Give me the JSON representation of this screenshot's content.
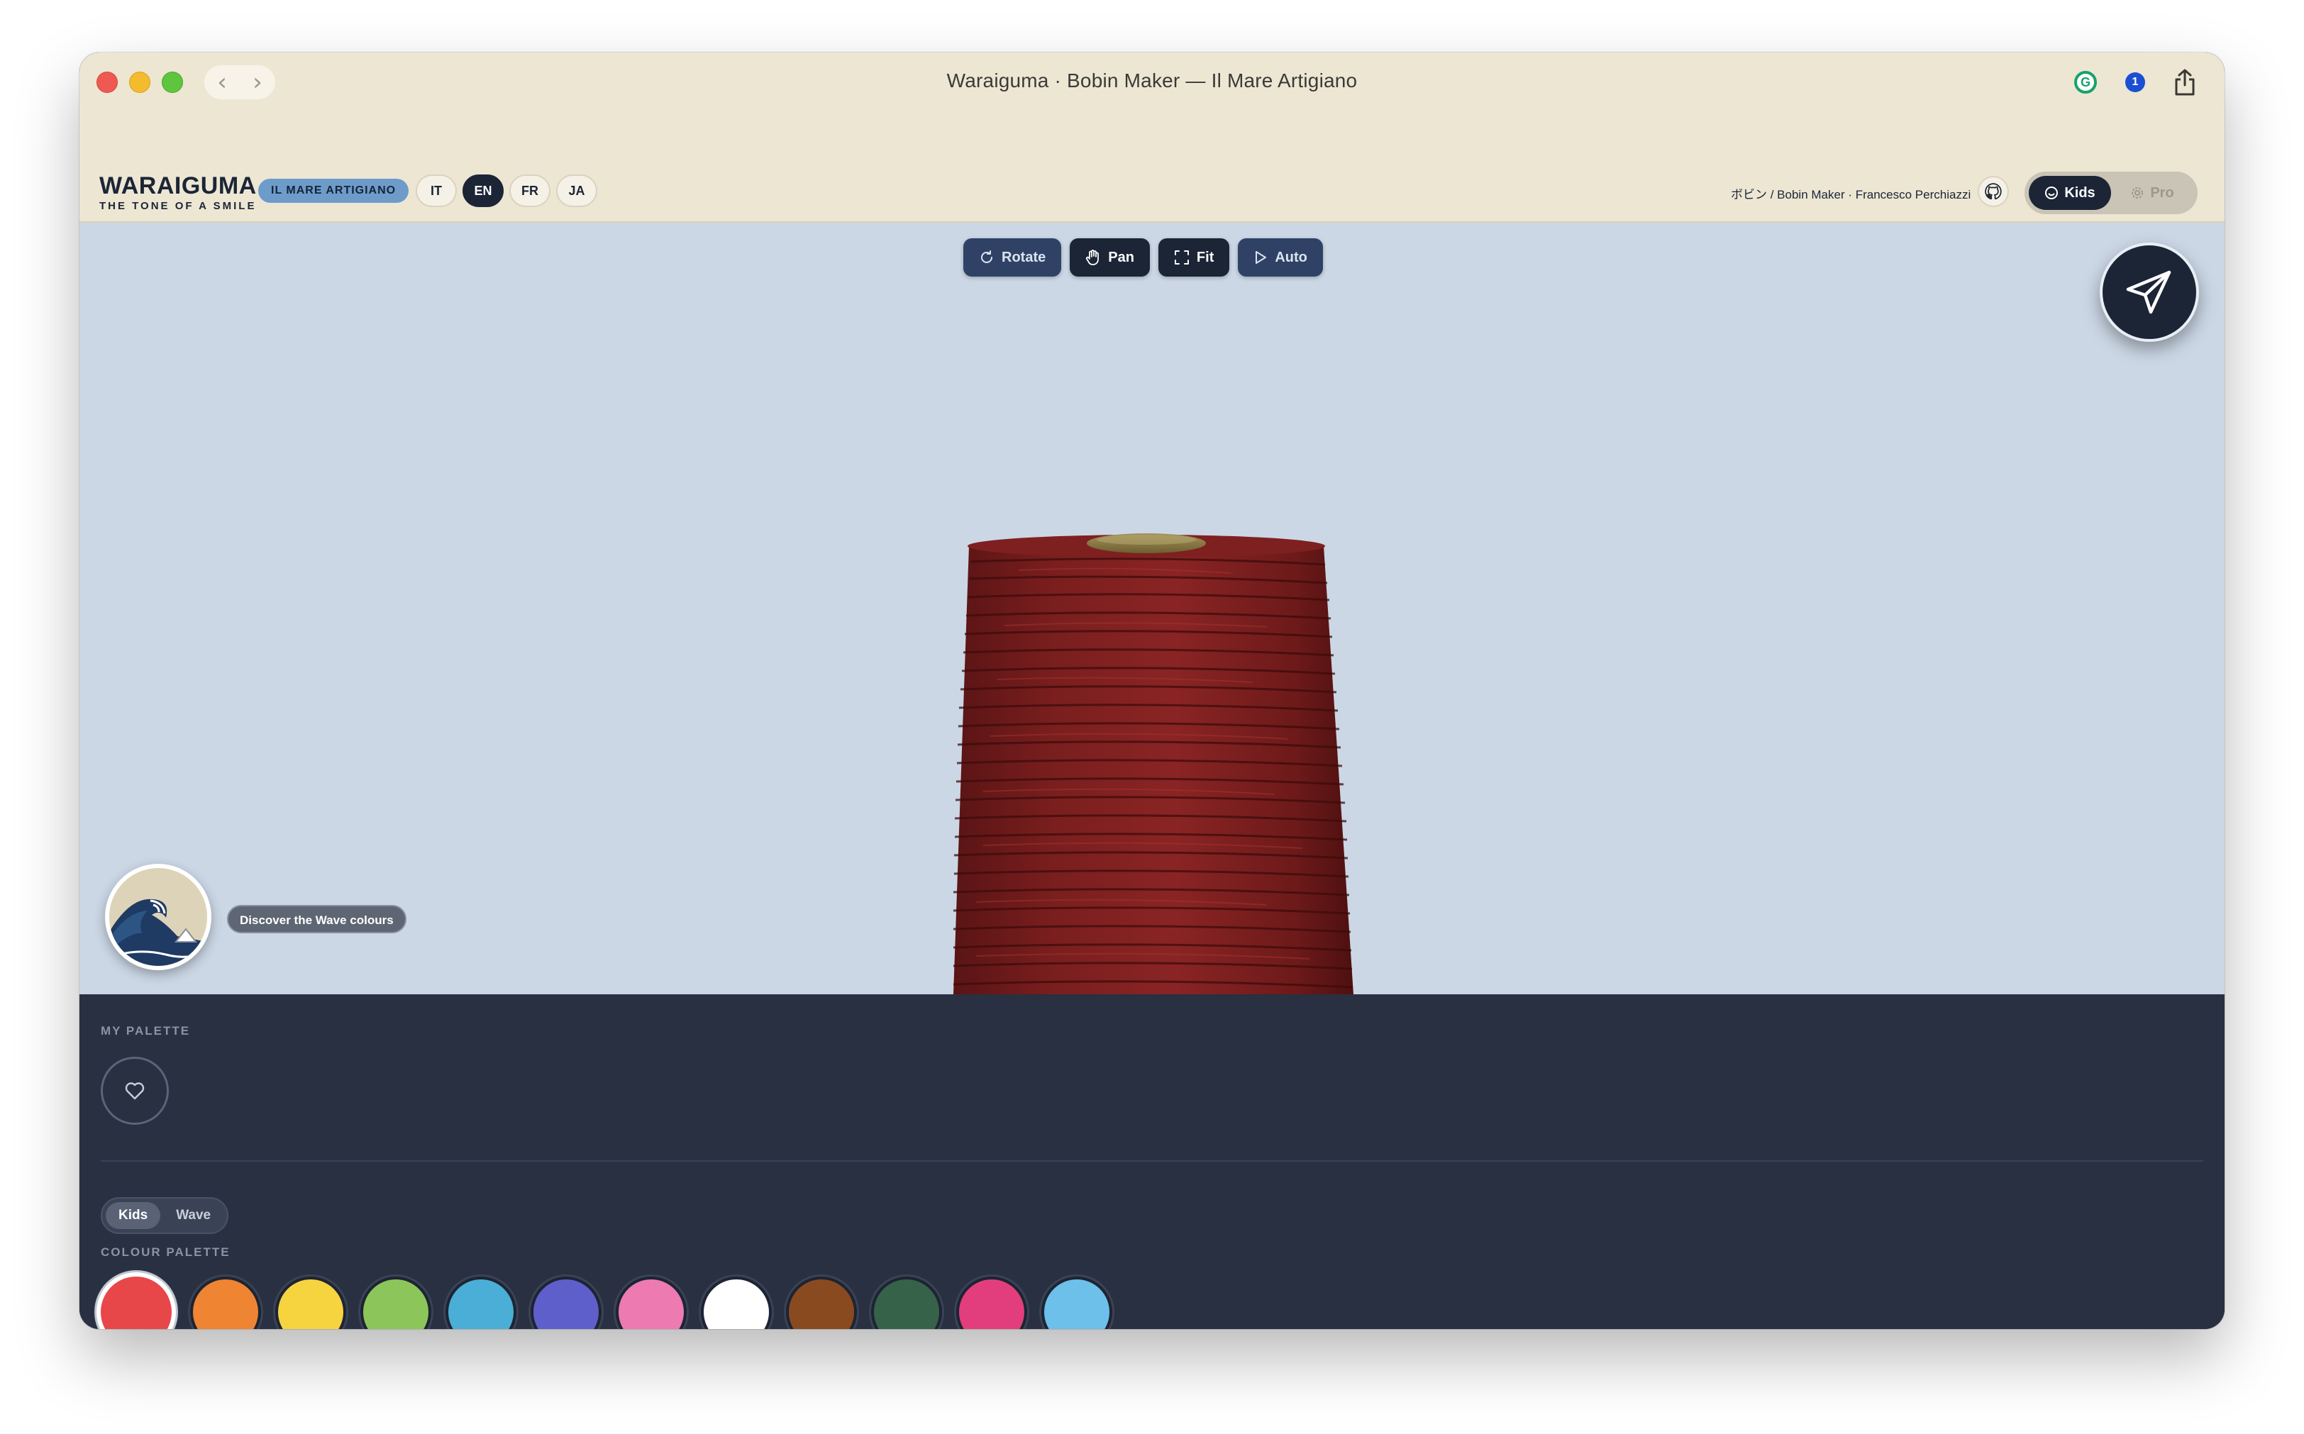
{
  "window": {
    "title": "Waraiguma · Bobin Maker — Il Mare Artigiano",
    "back_glyph": "‹",
    "forward_glyph": "›",
    "onepassword_count": "1"
  },
  "header": {
    "brand_title": "WARAIGUMA",
    "brand_subtitle": "THE TONE OF A SMILE",
    "badge": "IL MARE ARTIGIANO",
    "languages": [
      {
        "code": "IT",
        "active": false
      },
      {
        "code": "EN",
        "active": true
      },
      {
        "code": "FR",
        "active": false
      },
      {
        "code": "JA",
        "active": false
      }
    ],
    "credit": "ボビン / Bobin Maker · Francesco Perchiazzi",
    "modes": {
      "kids": "Kids",
      "pro": "Pro",
      "active": "Kids"
    }
  },
  "toolbar": {
    "rotate": "Rotate",
    "pan": "Pan",
    "fit": "Fit",
    "auto": "Auto"
  },
  "viewport": {
    "wave_tooltip": "Discover the Wave colours",
    "bobbin_color": "#7a1e1e"
  },
  "panel": {
    "my_palette_label": "MY PALETTE",
    "colour_palette_label": "COLOUR PALETTE",
    "palette_tabs": [
      {
        "label": "Kids",
        "active": true
      },
      {
        "label": "Wave",
        "active": false
      }
    ],
    "swatches": [
      {
        "color": "#e8474a",
        "selected": true
      },
      {
        "color": "#ef8433",
        "selected": false
      },
      {
        "color": "#f6d440",
        "selected": false
      },
      {
        "color": "#8cc65a",
        "selected": false
      },
      {
        "color": "#4aaed7",
        "selected": false
      },
      {
        "color": "#5e5fcb",
        "selected": false
      },
      {
        "color": "#ee7ab2",
        "selected": false
      },
      {
        "color": "#ffffff",
        "selected": false
      },
      {
        "color": "#8a4a20",
        "selected": false
      },
      {
        "color": "#37624a",
        "selected": false
      },
      {
        "color": "#e23e7d",
        "selected": false
      },
      {
        "color": "#6cc0ea",
        "selected": false
      }
    ]
  }
}
